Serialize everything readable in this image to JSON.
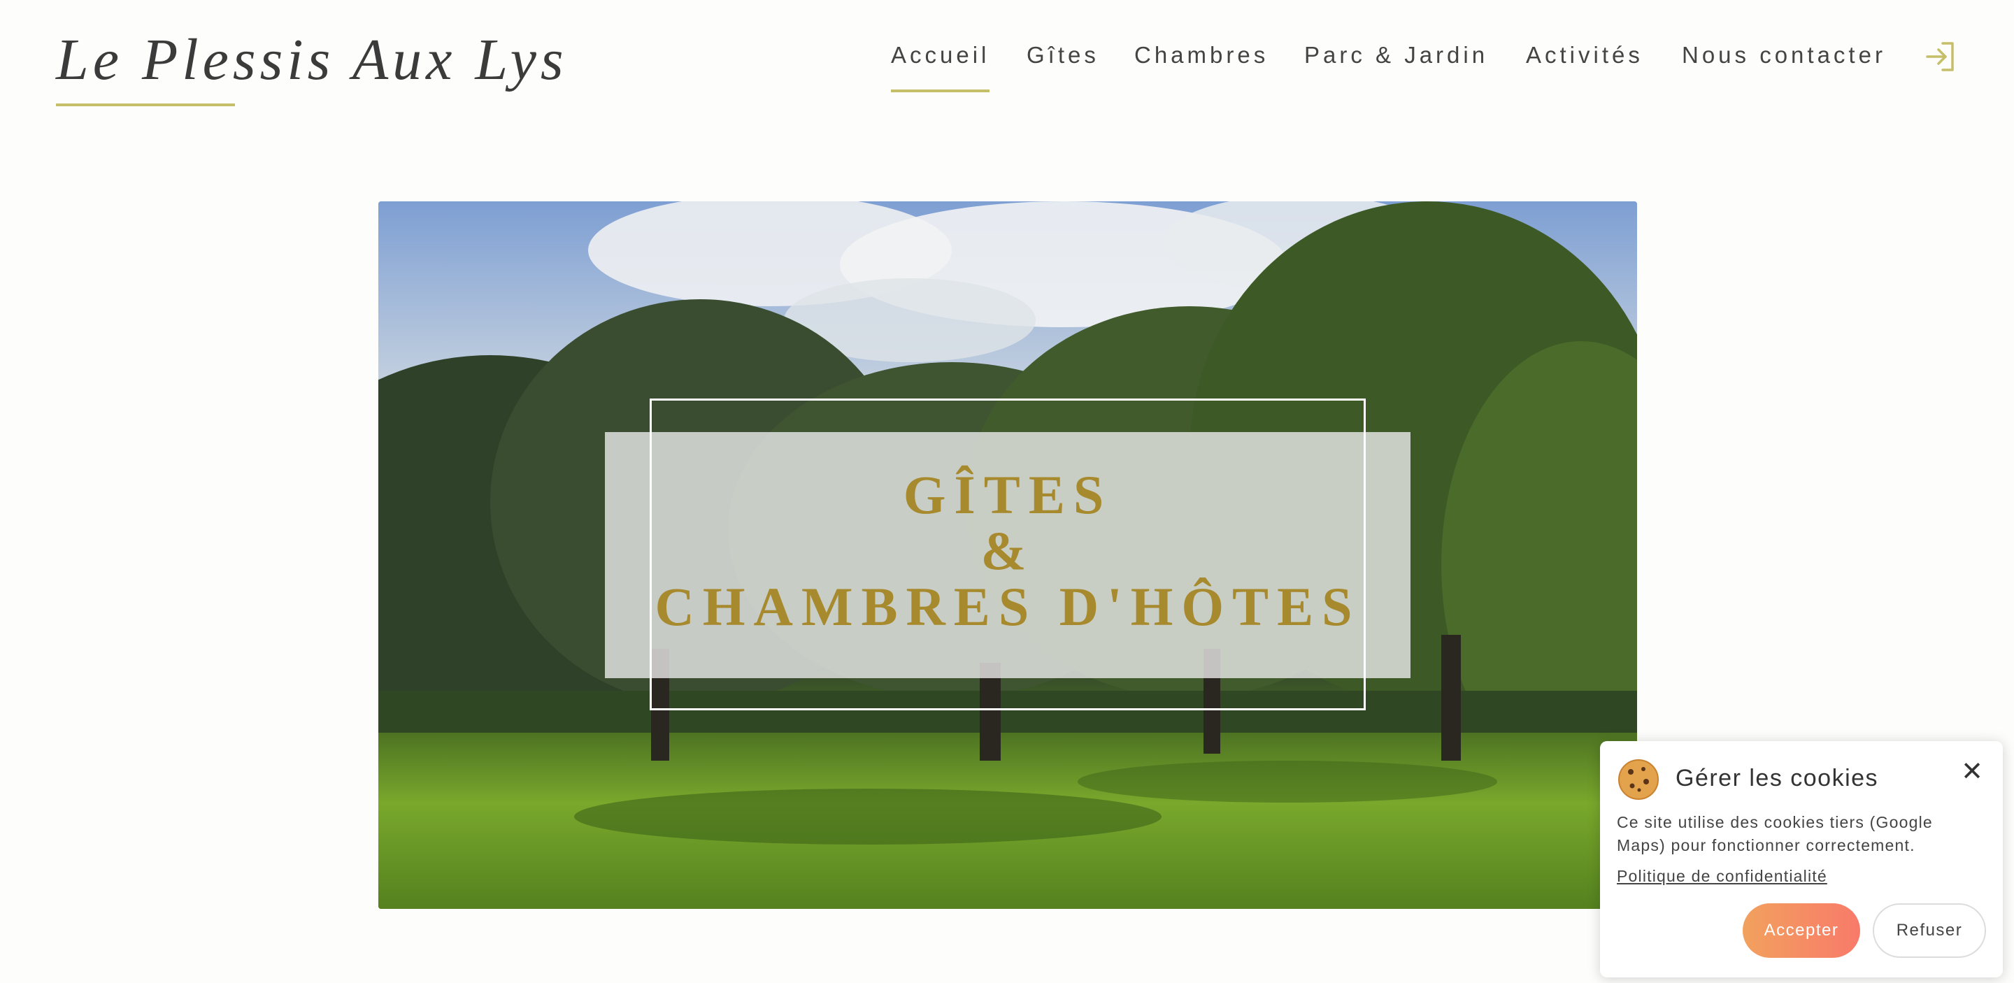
{
  "site": {
    "brand": "Le Plessis Aux Lys",
    "accent_color": "#c6bf6a"
  },
  "nav": {
    "items": [
      {
        "label": "Accueil",
        "active": true
      },
      {
        "label": "Gîtes",
        "active": false
      },
      {
        "label": "Chambres",
        "active": false
      },
      {
        "label": "Parc & Jardin",
        "active": false
      },
      {
        "label": "Activités",
        "active": false
      },
      {
        "label": "Nous contacter",
        "active": false
      }
    ],
    "login_icon": "login-icon"
  },
  "hero": {
    "title_lines": [
      "GÎTES",
      "&",
      "CHAMBRES D'HÔTES"
    ],
    "title_color": "#a88a2e",
    "image_subject": "park-trees-photo"
  },
  "cookies": {
    "icon": "cookie-icon",
    "title": "Gérer les cookies",
    "close_icon": "close-icon",
    "text": "Ce site utilise des cookies tiers (Google Maps) pour fonctionner correctement.",
    "policy_link": "Politique de confidentialité",
    "accept_label": "Accepter",
    "refuse_label": "Refuser",
    "accept_gradient": [
      "#f2a15e",
      "#f87a6a"
    ]
  }
}
